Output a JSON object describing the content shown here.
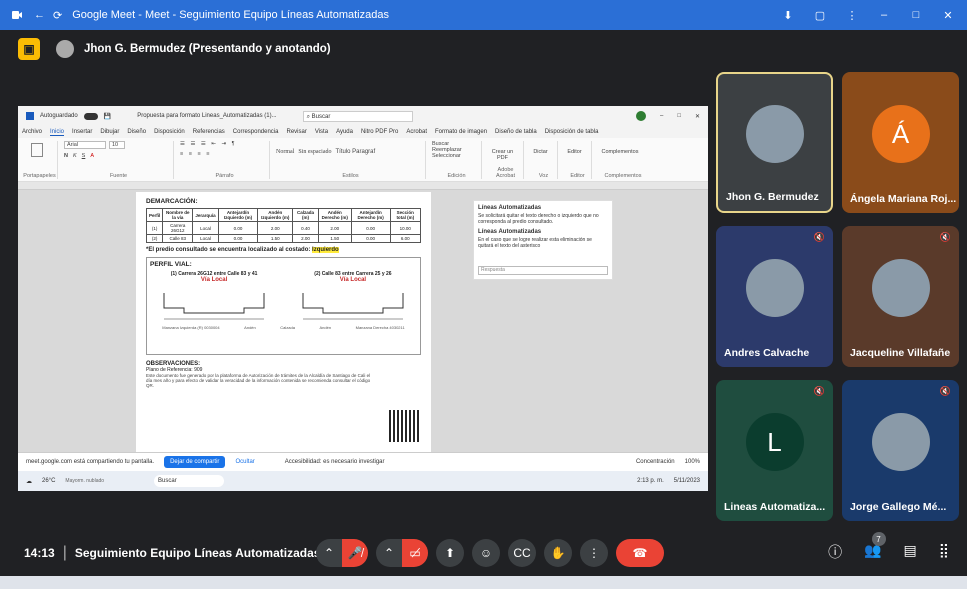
{
  "browser": {
    "title": "Google Meet - Meet - Seguimiento Equipo Líneas Automatizadas"
  },
  "presenter": {
    "label": "Jhon G. Bermudez (Presentando y anotando)"
  },
  "word": {
    "autosave": "Autoguardado",
    "doc_title": "Propuesta para formato Lineas_Automatizadas (1)... ",
    "search_placeholder": "Buscar",
    "menu": [
      "Archivo",
      "Inicio",
      "Insertar",
      "Dibujar",
      "Diseño",
      "Disposición",
      "Referencias",
      "Correspondencia",
      "Revisar",
      "Vista",
      "Ayuda",
      "Nitro PDF Pro",
      "Acrobat",
      "Formato de imagen",
      "Diseño de tabla",
      "Disposición de tabla"
    ],
    "active_menu": "Inicio",
    "ribbon_groups": [
      "Portapapeles",
      "Fuente",
      "Párrafo",
      "Estilos",
      "Edición",
      "Adobe Acrobat",
      "Voz",
      "Editor",
      "Complementos"
    ],
    "font_name": "Arial",
    "font_size": "10",
    "styles": [
      "Normal",
      "Sin espaciado",
      "Título Paragraf"
    ],
    "edit_items": [
      "Buscar",
      "Reemplazar",
      "Seleccionar"
    ],
    "acrobat_item": "Crear un PDF",
    "voice_item": "Dictar",
    "editor_item": "Editor",
    "addins_item": "Complementos"
  },
  "document": {
    "demarcation_title": "DEMARCACIÓN:",
    "table_headers": [
      "Perfil",
      "Nombre de la vía",
      "Jerarquía",
      "Antejardín Izquierdo (m)",
      "Andén Izquierdo (m)",
      "Calzada (m)",
      "Andén Derecho (m)",
      "Antejardín Derecho (m)",
      "Sección total (m)"
    ],
    "table_rows": [
      [
        "(1)",
        "Carrera 26G12",
        "Local",
        "0.00",
        "2.00",
        "0.40",
        "2.00",
        "0.00",
        "10.00"
      ],
      [
        "(2)",
        "Calle 83",
        "Local",
        "0.00",
        "1.50",
        "2.00",
        "1.50",
        "0.00",
        "6.00"
      ]
    ],
    "side_note_prefix": "*El predio consultado se encuentra localizado al costado: ",
    "side_note_value": "Izquierdo",
    "profile_title": "PERFIL VIAL:",
    "profile_left_title": "(1) Carrera 26G12 entre Calle 83 y 41",
    "profile_left_type": "Vía Local",
    "profile_right_title": "(2) Calle 83 entre Carrera 25 y 26",
    "profile_right_type": "Vía Local",
    "profile_labels": [
      "Manzana Izquierda (R) 0030004",
      "Manzana Derecha 4030211",
      "Andén",
      "Calzada",
      "Andén"
    ],
    "obs_title": "OBSERVACIONES:",
    "obs_plan": "Plano de Referencia: 909",
    "obs_text": "Este documento fue generado por la plataforma de Autorización de trámites de la Alcaldía de Santiago de Cali el día mes año y para efecto de validar la veracidad de la información contenida se recomienda consultar el código QR.",
    "watermark": "LÍNEA DE DEMARCACIÓN"
  },
  "comment": {
    "title": "Líneas Automatizadas",
    "text1": "Se solicitará quitar el texto derecho o izquierdo que no corresponda al predio consultado.",
    "title2": "Líneas Automatizadas",
    "text2": "En el caso que se logre realizar esta eliminación se quitará el texto del asterisco",
    "reply_placeholder": "Respuesta"
  },
  "share_notice": {
    "text": "meet.google.com está compartiendo tu pantalla.",
    "stop": "Dejar de compartir",
    "hide": "Ocultar"
  },
  "inner_status": {
    "accessibility": "Accesibilidad: es necesario investigar",
    "focus": "Concentración",
    "zoom": "100%"
  },
  "inner_taskbar": {
    "weather": "26°C",
    "weather_sub": "Mayorm. nublado",
    "search": "Buscar",
    "clock": "2:13 p. m.",
    "date": "5/11/2023"
  },
  "participants": [
    {
      "name": "Jhon G. Bermudez",
      "muted": false,
      "avatar_letter": "",
      "color": "#3c4043",
      "active": true
    },
    {
      "name": "Ángela Mariana Roj...",
      "muted": false,
      "avatar_letter": "Á",
      "color": "#8a4b1a",
      "active": false
    },
    {
      "name": "Andres Calvache",
      "muted": true,
      "avatar_letter": "",
      "color": "#2c3a6b",
      "active": false
    },
    {
      "name": "Jacqueline Villafañe",
      "muted": true,
      "avatar_letter": "",
      "color": "#5a3a2a",
      "active": false
    },
    {
      "name": "Lineas Automatiza...",
      "muted": true,
      "avatar_letter": "L",
      "color": "#1f4d3f",
      "active": false
    },
    {
      "name": "Jorge Gallego Mé...",
      "muted": true,
      "avatar_letter": "",
      "color": "#1a3a6b",
      "active": false
    }
  ],
  "bottom": {
    "time": "14:13",
    "meeting_name": "Seguimiento Equipo Líneas Automatizadas",
    "people_count": "7"
  },
  "colors": {
    "meet_bg": "#202124",
    "end_call": "#ea4335",
    "titlebar": "#2b6fd6",
    "presenter_icon": "#fbbc04"
  }
}
